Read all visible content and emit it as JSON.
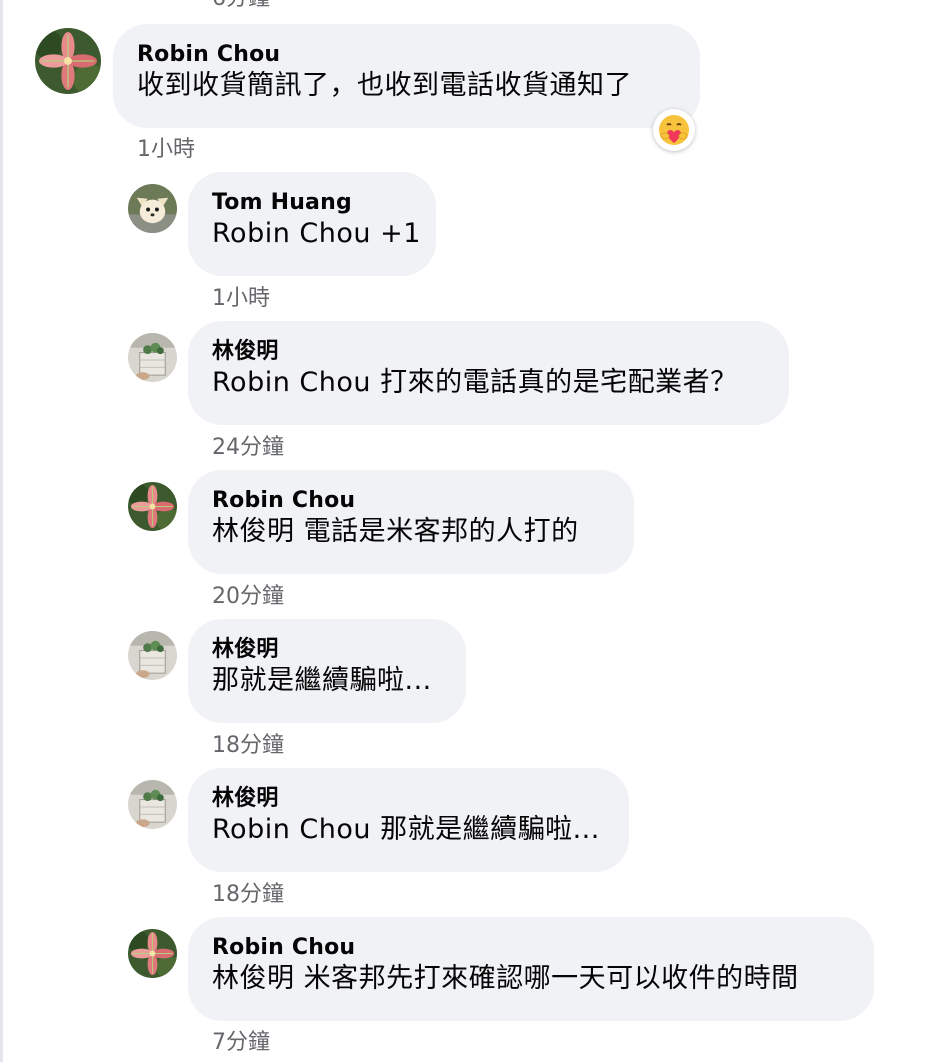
{
  "top_fragment_timestamp": "6分鐘",
  "comments": [
    {
      "author": "Robin Chou",
      "text": "收到收貨簡訊了，也收到電話收貨通知了",
      "timestamp": "1小時",
      "reaction_icon": "care-reaction-icon",
      "avatar_icon": "pink-flower-avatar"
    },
    {
      "author": "Tom Huang",
      "text": "Robin Chou +1",
      "timestamp": "1小時",
      "avatar_icon": "chihuahua-avatar"
    },
    {
      "author": "林俊明",
      "text": "Robin Chou 打來的電話真的是宅配業者？",
      "timestamp": "24分鐘",
      "avatar_icon": "potted-plant-avatar"
    },
    {
      "author": "Robin Chou",
      "text": "林俊明 電話是米客邦的人打的",
      "timestamp": "20分鐘",
      "avatar_icon": "pink-flower-avatar"
    },
    {
      "author": "林俊明",
      "text": "那就是繼續騙啦...",
      "timestamp": "18分鐘",
      "avatar_icon": "potted-plant-avatar"
    },
    {
      "author": "林俊明",
      "text": "Robin Chou 那就是繼續騙啦...",
      "timestamp": "18分鐘",
      "avatar_icon": "potted-plant-avatar"
    },
    {
      "author": "Robin Chou",
      "text": "林俊明 米客邦先打來確認哪一天可以收件的時間",
      "timestamp": "7分鐘",
      "avatar_icon": "pink-flower-avatar"
    }
  ],
  "colors": {
    "bubble_bg": "#f0f2f5",
    "text": "#050505",
    "timestamp": "#65676b",
    "divider": "#e4e6eb"
  }
}
